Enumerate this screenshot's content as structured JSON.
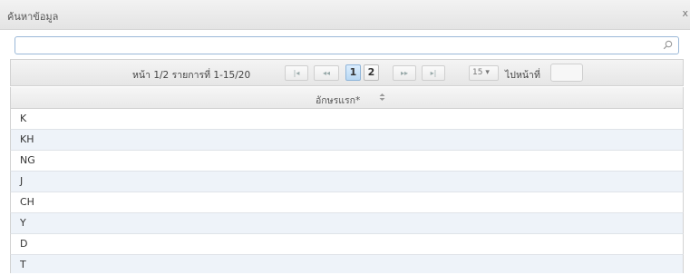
{
  "window": {
    "title": "ค้นหาข้อมูล",
    "close_glyph": "x"
  },
  "search": {
    "value": "",
    "placeholder": ""
  },
  "pager": {
    "info": "หน้า 1/2 รายการที่ 1-15/20",
    "first": "|◂",
    "prev": "◂◂",
    "pages": [
      "1",
      "2"
    ],
    "active_page": "1",
    "next": "▸▸",
    "last": "▸|",
    "page_size": "15 ▾",
    "goto_label": "ไปหน้าที่",
    "goto_value": ""
  },
  "table": {
    "column": "อักษรแรก*",
    "rows": [
      "K",
      "KH",
      "NG",
      "J",
      "CH",
      "Y",
      "D",
      "T"
    ]
  }
}
